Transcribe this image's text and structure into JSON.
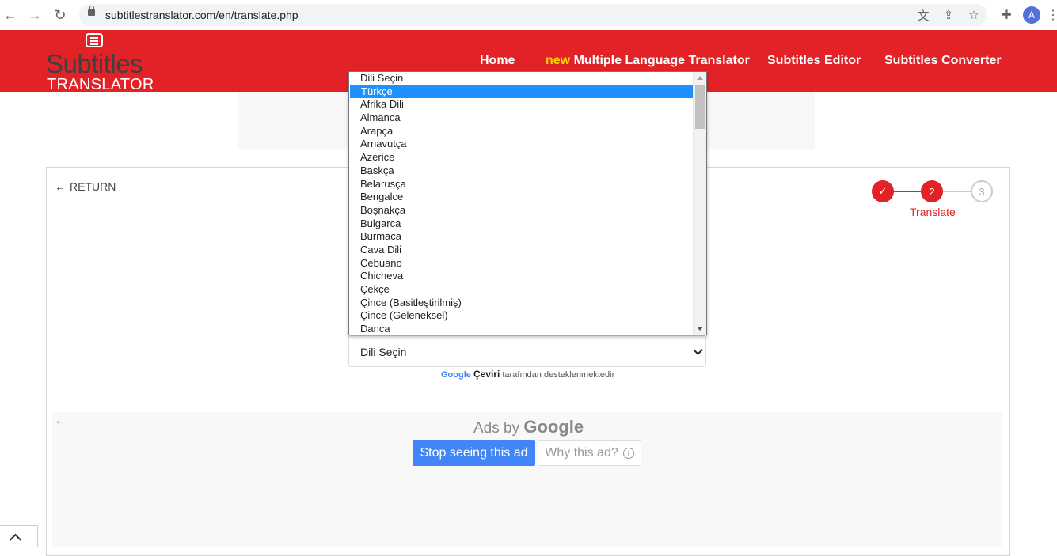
{
  "browser": {
    "url": "subtitlestranslator.com/en/translate.php",
    "avatar_letter": "A"
  },
  "site": {
    "logo_top": "Subtitles",
    "logo_bottom": "TRANSLATOR",
    "nav": {
      "home": "Home",
      "new_badge": "new",
      "multi": "Multiple Language Translator",
      "editor": "Subtitles Editor",
      "converter": "Subtitles Converter"
    },
    "brand_color": "#e32227"
  },
  "card": {
    "return_label": "RETURN",
    "steps": {
      "step1": "✓",
      "step2": "2",
      "step3": "3",
      "current_label": "Translate"
    },
    "language_select": {
      "value": "Dili Seçin",
      "options": [
        "Dili Seçin",
        "Türkçe",
        "Afrika Dili",
        "Almanca",
        "Arapça",
        "Arnavutça",
        "Azerice",
        "Baskça",
        "Belarusça",
        "Bengalce",
        "Boşnakça",
        "Bulgarca",
        "Burmaca",
        "Cava Dili",
        "Cebuano",
        "Chicheva",
        "Çekçe",
        "Çince (Basitleştirilmiş)",
        "Çince (Geleneksel)",
        "Danca"
      ],
      "highlighted_index": 1
    },
    "powered_by": {
      "google": "Google",
      "ceviri": "Çeviri",
      "suffix": "tarafından desteklenmektedir"
    }
  },
  "ads": {
    "ads_by": "Ads by",
    "google": "Google",
    "stop_label": "Stop seeing this ad",
    "why_label": "Why this ad?",
    "info_glyph": "i"
  }
}
